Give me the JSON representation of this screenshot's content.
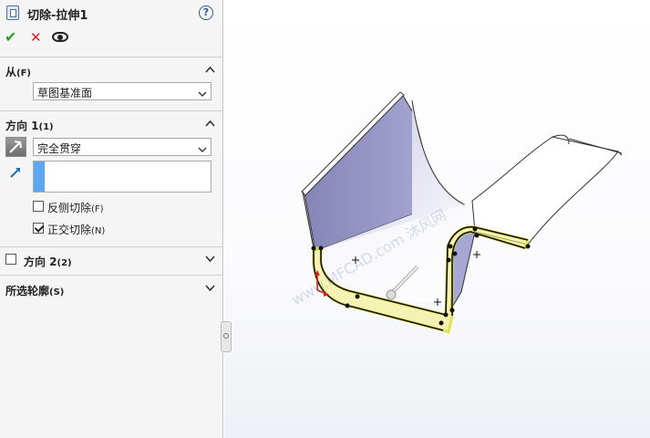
{
  "panel": {
    "title": "切除-拉伸1",
    "help_glyph": "?",
    "ok_glyph": "✔",
    "cancel_glyph": "✕",
    "from": {
      "label": "从",
      "shortcut": "(F)",
      "selected": "草图基准面"
    },
    "direction1": {
      "label": "方向 1",
      "shortcut": "(1)",
      "end_condition": "完全贯穿",
      "flip_side": {
        "label": "反侧切除",
        "shortcut": "(F)",
        "checked": false
      },
      "normal_cut": {
        "label": "正交切除",
        "shortcut": "(N)",
        "checked": true
      }
    },
    "direction2": {
      "label": "方向 2",
      "shortcut": "(2)",
      "checked": false
    },
    "selected_contours": {
      "label": "所选轮廓",
      "shortcut": "(S)"
    }
  },
  "viewport": {
    "watermark": "www.MFCAD.com 沐风网"
  },
  "colors": {
    "accent_blue": "#5aa7f2",
    "ok_green": "#2a9d2a",
    "cancel_red": "#d42020",
    "sheet_fill": "#9c9cc9",
    "highlight_yellow": "#f0ef7a"
  }
}
